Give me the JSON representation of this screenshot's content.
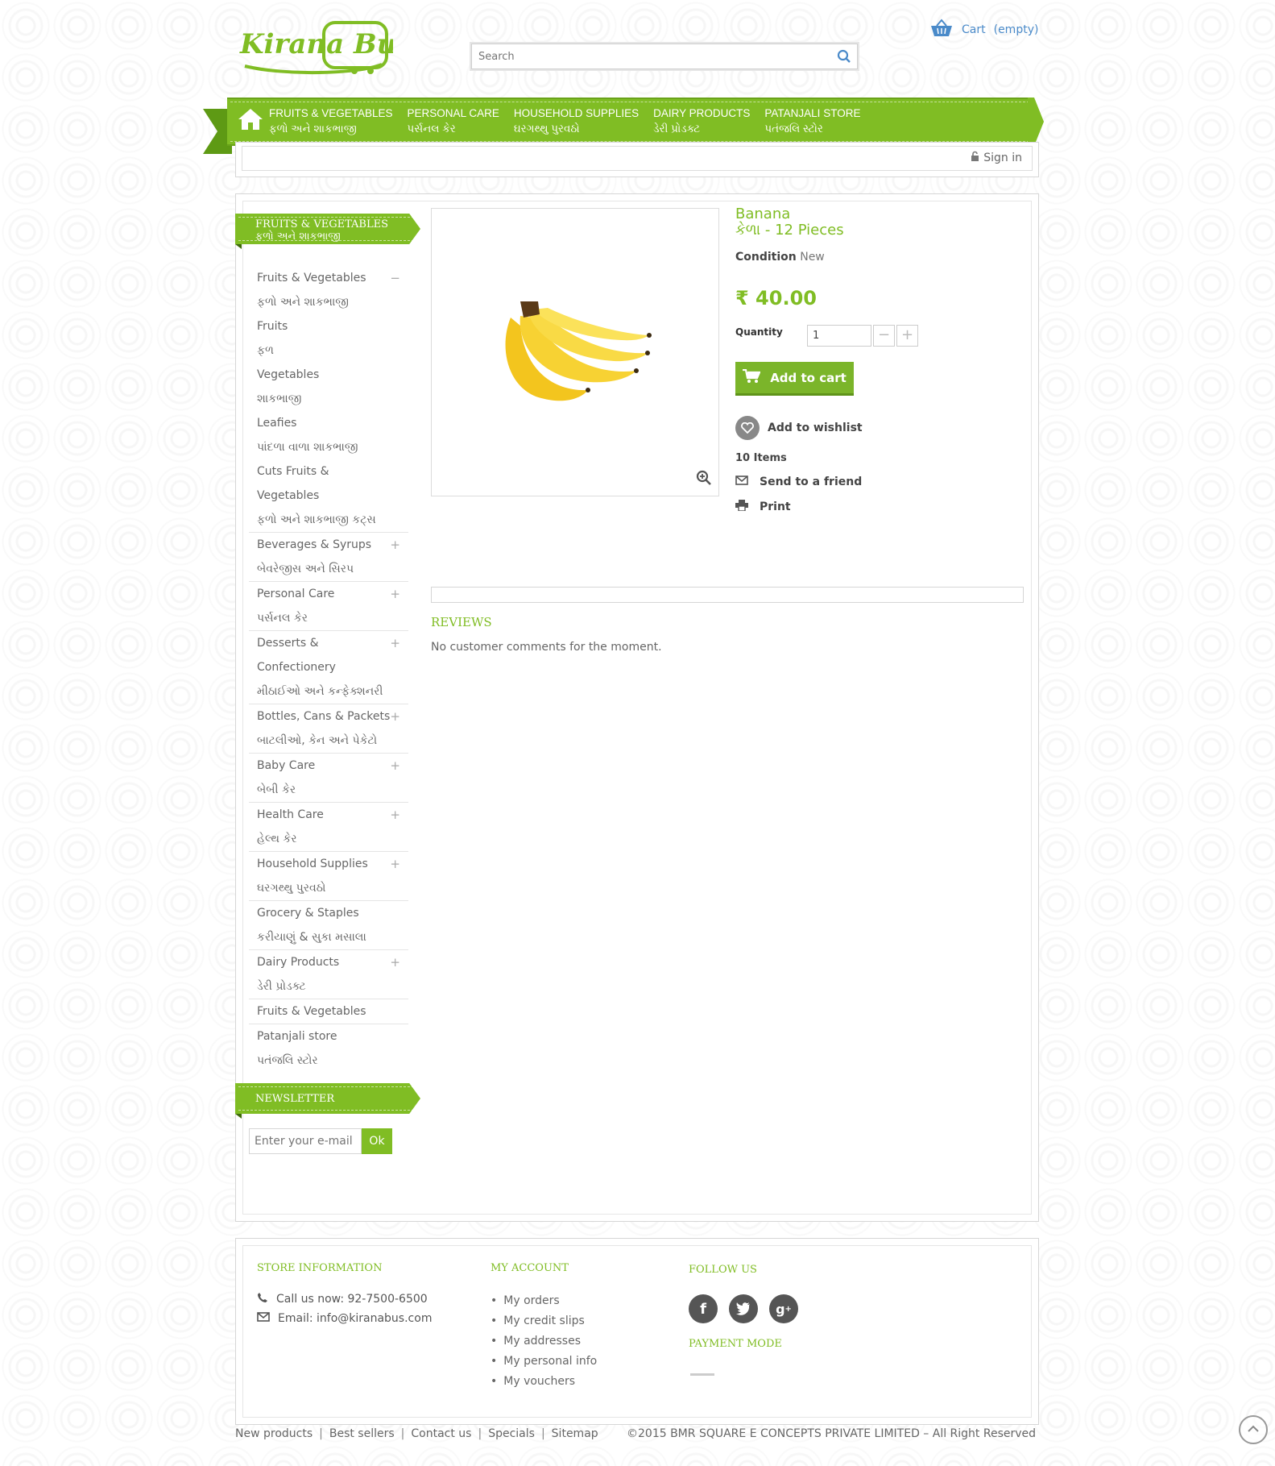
{
  "brand": {
    "logo_text": "Kirana Bus"
  },
  "search": {
    "placeholder": "Search"
  },
  "cart": {
    "label": "Cart",
    "status": "(empty)"
  },
  "nav": {
    "items": [
      {
        "en": "FRUITS & VEGETABLES",
        "gu": "ફળો અને શાકભાજી"
      },
      {
        "en": "PERSONAL CARE",
        "gu": "પર્સનલ કેર"
      },
      {
        "en": "HOUSEHOLD SUPPLIES",
        "gu": "ઘરગથ્થુ પુરવઠો"
      },
      {
        "en": "DAIRY PRODUCTS",
        "gu": "ડેરી પ્રોડક્ટ"
      },
      {
        "en": "PATANJALI STORE",
        "gu": "પતંજલિ સ્ટોર"
      }
    ]
  },
  "account": {
    "signin": "Sign in"
  },
  "sidebar": {
    "title_en": "FRUITS & VEGETABLES",
    "title_gu": "ફળો અને શાકભાજી",
    "categories": [
      {
        "lines": [
          "Fruits & Vegetables",
          "ફળો અને શાકભાજી",
          "Fruits",
          "ફળ",
          "Vegetables",
          "શાકભાજી",
          "Leafies",
          "પાંદળા વાળા શાકભાજી",
          "Cuts Fruits &",
          "Vegetables",
          "ફળો અને શાકભાજી કટ્સ"
        ],
        "toggle": "−"
      },
      {
        "lines": [
          "Beverages & Syrups",
          "બેવરેજીસ અને સિરપ"
        ],
        "toggle": "+"
      },
      {
        "lines": [
          "Personal Care",
          "પર્સનલ કેર"
        ],
        "toggle": "+"
      },
      {
        "lines": [
          "Desserts &",
          "Confectionery",
          "મીઠાઈઓ અને કન્ફેક્શનરી"
        ],
        "toggle": "+"
      },
      {
        "lines": [
          "Bottles, Cans & Packets",
          "બાટલીઓ, કેન અને પેકેટો"
        ],
        "toggle": "+"
      },
      {
        "lines": [
          "Baby Care",
          "બેબી કેર"
        ],
        "toggle": "+"
      },
      {
        "lines": [
          "Health Care",
          "હેલ્થ કેર"
        ],
        "toggle": "+"
      },
      {
        "lines": [
          "Household Supplies",
          "ઘરગથ્થુ પુરવઠો"
        ],
        "toggle": "+"
      },
      {
        "lines": [
          "Grocery & Staples",
          "કરીયાણું & સુકા મસાલા"
        ],
        "toggle": ""
      },
      {
        "lines": [
          "Dairy Products",
          "ડેરી પ્રોડક્ટ"
        ],
        "toggle": "+"
      },
      {
        "lines": [
          "Fruits & Vegetables"
        ],
        "toggle": ""
      },
      {
        "lines": [
          "Patanjali store",
          "પતંજલિ સ્ટોર"
        ],
        "toggle": ""
      }
    ]
  },
  "newsletter": {
    "title": "NEWSLETTER",
    "placeholder": "Enter your e-mail",
    "button": "Ok"
  },
  "product": {
    "name": "Banana",
    "subtitle": "કેળા - 12 Pieces",
    "condition_label": "Condition",
    "condition_value": "New",
    "price": "₹ 40.00",
    "quantity_label": "Quantity",
    "quantity_value": "1",
    "add_to_cart": "Add to cart",
    "add_to_wishlist": "Add to wishlist",
    "items_count": "10 Items",
    "send_to_friend": "Send to a friend",
    "print": "Print"
  },
  "reviews": {
    "title": "REVIEWS",
    "empty_text": "No customer comments for the moment."
  },
  "footer": {
    "store_info": {
      "title": "STORE INFORMATION",
      "phone": "Call us now: 92-7500-6500",
      "email": "Email: info@kiranabus.com"
    },
    "my_account": {
      "title": "MY ACCOUNT",
      "links": [
        "My orders",
        "My credit slips",
        "My addresses",
        "My personal info",
        "My vouchers"
      ]
    },
    "follow": {
      "title": "FOLLOW US",
      "networks": [
        "facebook-icon",
        "twitter-icon",
        "google-plus-icon"
      ]
    },
    "payment": {
      "title": "PAYMENT MODE"
    }
  },
  "bottom": {
    "links": [
      "New products",
      "Best sellers",
      "Contact us",
      "Specials",
      "Sitemap"
    ],
    "copyright": "©2015 BMR SQUARE E CONCEPTS PRIVATE LIMITED – All Right Reserved"
  },
  "colors": {
    "accent": "#80bd24",
    "link_blue": "#4a8ac9"
  }
}
